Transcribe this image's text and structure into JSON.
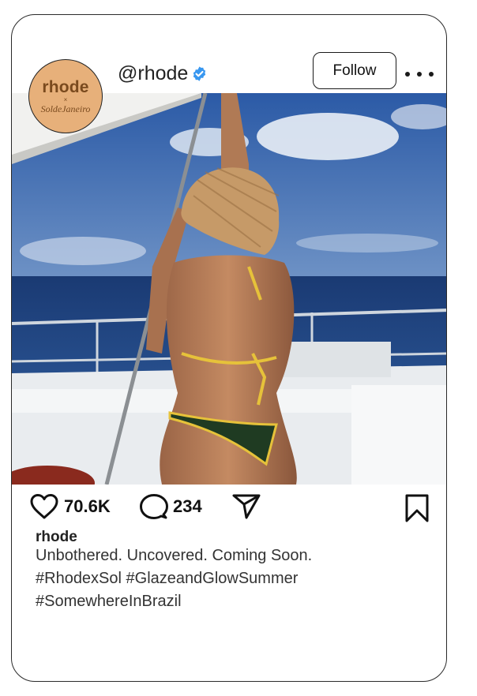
{
  "post": {
    "avatar": {
      "brand_line1": "rhode",
      "brand_x": "×",
      "brand_line2": "SoldeJaneiro"
    },
    "handle": "@rhode",
    "follow_label": "Follow",
    "likes": "70.6K",
    "comments": "234",
    "username": "rhode",
    "caption_lines": [
      "Unbothered. Uncovered. Coming Soon.",
      "#RhodexSol #GlazeandGlowSummer",
      "#SomewhereInBrazil"
    ]
  },
  "colors": {
    "verified": "#3897f0",
    "avatar_bg": "#e7b07a",
    "sky": "#2f5fa8",
    "sea": "#1d3f78"
  },
  "icons": [
    "verified-badge-icon",
    "more-options-icon",
    "heart-icon",
    "comment-icon",
    "share-icon",
    "bookmark-icon"
  ]
}
